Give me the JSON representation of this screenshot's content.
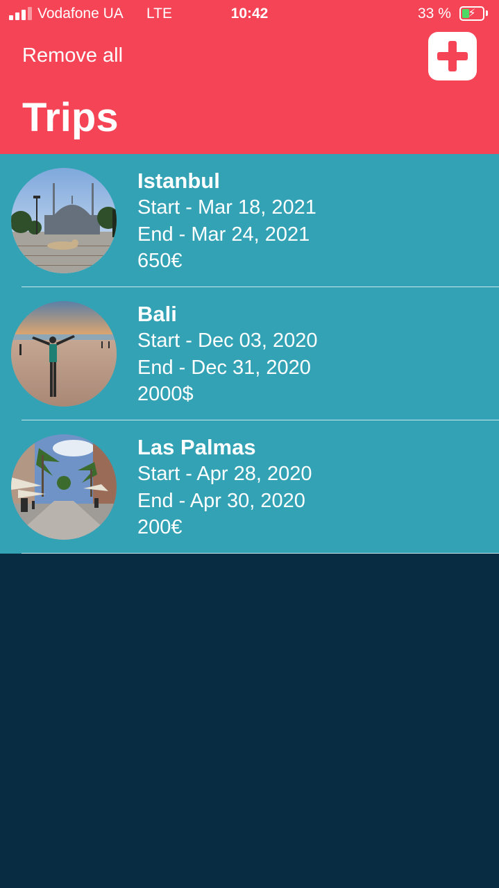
{
  "status_bar": {
    "carrier": "Vodafone UA",
    "network": "LTE",
    "time": "10:42",
    "battery_percent": "33 %",
    "battery_level": 0.33,
    "icons": [
      "signal-icon",
      "battery-charging-icon"
    ]
  },
  "header": {
    "remove_all_label": "Remove all",
    "add_icon": "plus-icon",
    "title": "Trips"
  },
  "colors": {
    "header_bg": "#f64457",
    "row_bg": "#33a2b5",
    "page_bg": "#082c42",
    "text": "#ffffff",
    "battery_fill": "#4cd964"
  },
  "trips": [
    {
      "name": "Istanbul",
      "start": "Start - Mar 18, 2021",
      "end": "End - Mar 24, 2021",
      "price": "650€",
      "photo": "istanbul-mosque-photo"
    },
    {
      "name": "Bali",
      "start": "Start - Dec 03, 2020",
      "end": "End - Dec 31, 2020",
      "price": "2000$",
      "photo": "bali-beach-photo"
    },
    {
      "name": "Las Palmas",
      "start": "Start - Apr 28, 2020",
      "end": "End - Apr 30, 2020",
      "price": "200€",
      "photo": "las-palmas-street-photo"
    }
  ]
}
